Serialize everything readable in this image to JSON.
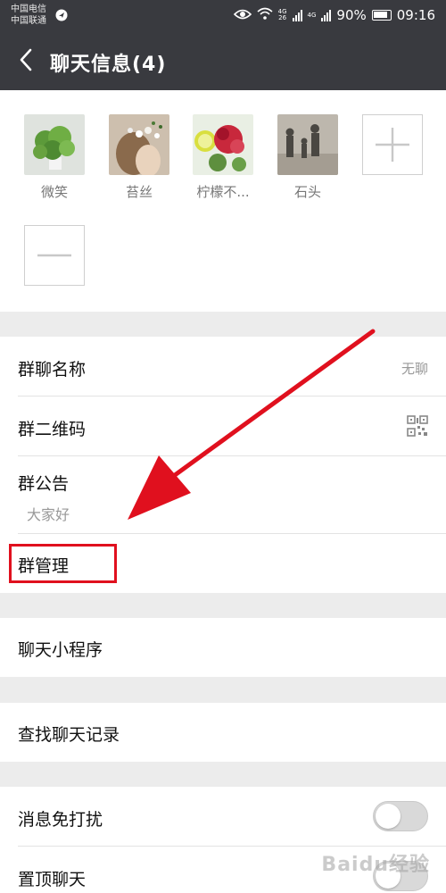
{
  "status_bar": {
    "carrier_1": "中国电信",
    "carrier_2": "中国联通",
    "network_1": "4G",
    "network_2": "4G",
    "battery": "90%",
    "time": "09:16"
  },
  "header": {
    "title": "聊天信息(4)",
    "back_icon": "chevron-left-icon",
    "background": "#393a3f"
  },
  "members": [
    {
      "name": "微笑"
    },
    {
      "name": "苔丝"
    },
    {
      "name": "柠檬不..."
    },
    {
      "name": "石头"
    }
  ],
  "member_controls": {
    "add_icon": "plus-icon",
    "remove_icon": "minus-icon"
  },
  "settings": {
    "group_name_label": "群聊名称",
    "group_name_value": "无聊",
    "qr_code_label": "群二维码",
    "announcement_label": "群公告",
    "announcement_value": "大家好",
    "group_manage_label": "群管理",
    "mini_programs_label": "聊天小程序",
    "search_history_label": "查找聊天记录",
    "mute_label": "消息免打扰",
    "mute_on": false,
    "pin_label": "置顶聊天",
    "pin_on": false
  },
  "annotation": {
    "color": "#e0101e"
  },
  "watermark": {
    "text": "Baidu经验"
  }
}
